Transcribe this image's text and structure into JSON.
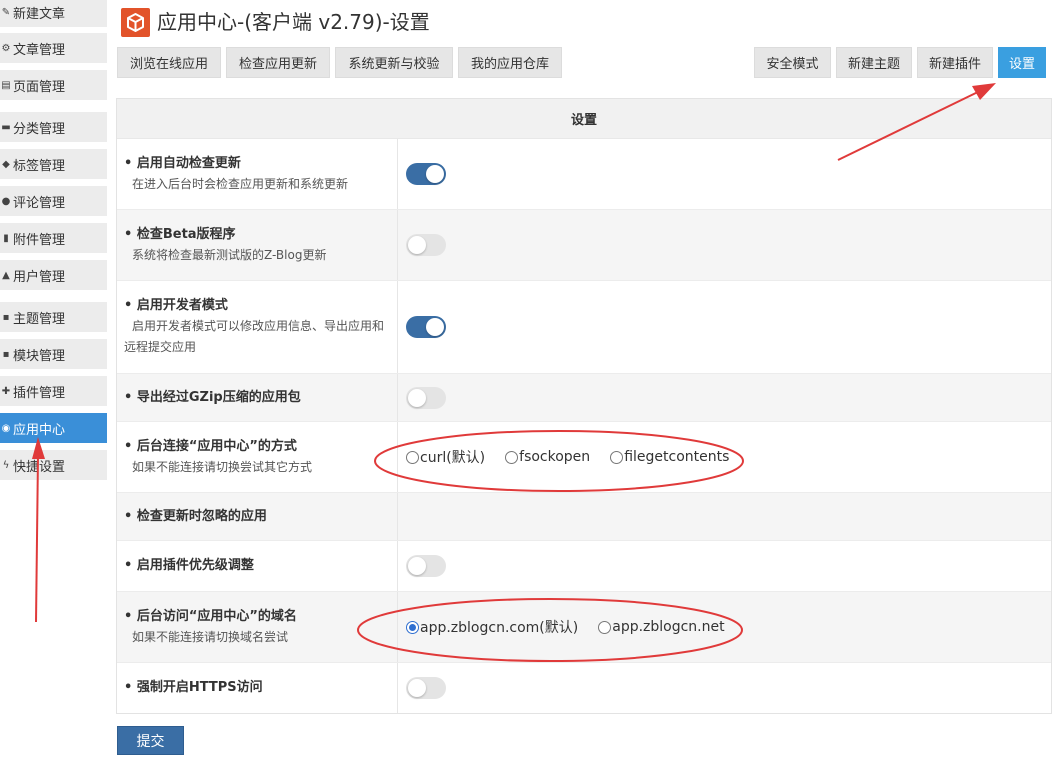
{
  "sidebar": {
    "items": [
      {
        "label": "新建文章",
        "icon": "pencil-icon"
      },
      {
        "label": "文章管理",
        "icon": "gear-icon"
      },
      {
        "label": "页面管理",
        "icon": "file-icon"
      },
      {
        "label": "分类管理",
        "icon": "folder-icon"
      },
      {
        "label": "标签管理",
        "icon": "tag-icon"
      },
      {
        "label": "评论管理",
        "icon": "comment-icon"
      },
      {
        "label": "附件管理",
        "icon": "paperclip-icon"
      },
      {
        "label": "用户管理",
        "icon": "user-icon"
      },
      {
        "label": "主题管理",
        "icon": "grid-icon"
      },
      {
        "label": "模块管理",
        "icon": "grid-icon"
      },
      {
        "label": "插件管理",
        "icon": "puzzle-icon"
      },
      {
        "label": "应用中心",
        "icon": "compass-icon",
        "active": true
      },
      {
        "label": "快捷设置",
        "icon": "bolt-icon"
      }
    ]
  },
  "header": {
    "title": "应用中心-(客户端 v2.79)-设置"
  },
  "tabs_left": [
    "浏览在线应用",
    "检查应用更新",
    "系统更新与校验",
    "我的应用仓库"
  ],
  "tabs_right": [
    "安全模式",
    "新建主题",
    "新建插件",
    "设置"
  ],
  "table": {
    "header": "设置",
    "rows": [
      {
        "title": "启用自动检查更新",
        "desc": "在进入后台时会检查应用更新和系统更新",
        "toggle": "on"
      },
      {
        "title": "检查Beta版程序",
        "desc": "系统将检查最新测试版的Z-Blog更新",
        "toggle": "off"
      },
      {
        "title": "启用开发者模式",
        "desc": "启用开发者模式可以修改应用信息、导出应用和远程提交应用",
        "toggle": "on"
      },
      {
        "title": "导出经过GZip压缩的应用包",
        "desc": "",
        "toggle": "off"
      },
      {
        "title": "后台连接“应用中心”的方式",
        "desc": "如果不能连接请切换尝试其它方式",
        "radios": [
          "curl(默认)",
          "fsockopen",
          "filegetcontents"
        ]
      },
      {
        "title": "检查更新时忽略的应用",
        "desc": ""
      },
      {
        "title": "启用插件优先级调整",
        "desc": "",
        "toggle": "off"
      },
      {
        "title": "后台访问“应用中心”的域名",
        "desc": "如果不能连接请切换域名尝试",
        "radios": [
          "app.zblogcn.com(默认)",
          "app.zblogcn.net"
        ],
        "selected": "app.zblogcn.com(默认)"
      },
      {
        "title": "强制开启HTTPS访问",
        "desc": "",
        "toggle": "off"
      }
    ]
  },
  "submit_label": "提交",
  "bullet": "•",
  "colors": {
    "accent_blue": "#3a9fe0",
    "toggle_on": "#3a6ea5",
    "annotation_red": "#e03a3a",
    "logo_orange": "#e2532a"
  }
}
